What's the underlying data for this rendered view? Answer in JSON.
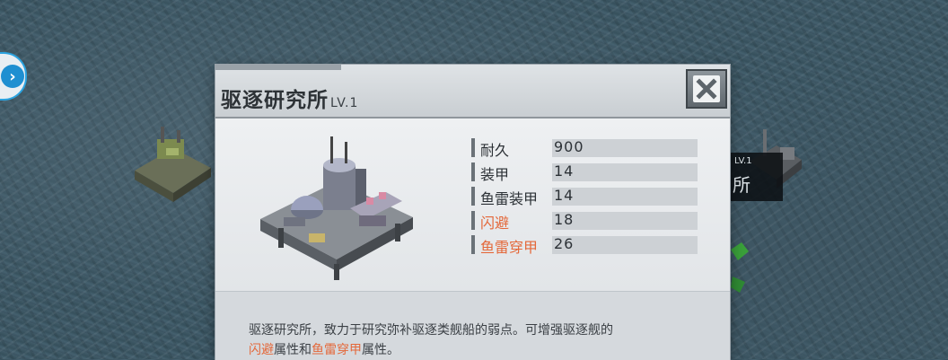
{
  "building": {
    "name": "驱逐研究所",
    "level": "LV.1"
  },
  "stats": [
    {
      "label": "耐久",
      "value": "900",
      "highlight": false
    },
    {
      "label": "装甲",
      "value": "14",
      "highlight": false
    },
    {
      "label": "鱼雷装甲",
      "value": "14",
      "highlight": false
    },
    {
      "label": "闪避",
      "value": "18",
      "highlight": true
    },
    {
      "label": "鱼雷穿甲",
      "value": "26",
      "highlight": true
    }
  ],
  "description": {
    "line1": "驱逐研究所，致力于研究弥补驱逐类舰船的弱点。可增强驱逐舰的",
    "line2_hl1": "闪避",
    "line2_mid": "属性和",
    "line2_hl2": "鱼雷穿甲",
    "line2_end": "属性。"
  },
  "background": {
    "label_level": "LV.1",
    "label_char": "所"
  },
  "colors": {
    "highlight": "#e4683a",
    "accent_blue": "#1f8fd1"
  },
  "icons": {
    "close": "close-icon",
    "side": "chevron-right-icon"
  }
}
